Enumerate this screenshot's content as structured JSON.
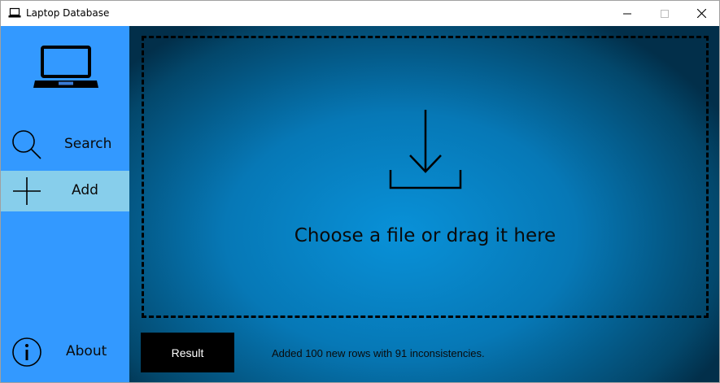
{
  "window": {
    "title": "Laptop Database",
    "app_icon": "laptop-icon",
    "controls": [
      "minimize-icon",
      "maximize-icon",
      "close-icon"
    ]
  },
  "sidebar": {
    "logo_icon": "laptop-icon",
    "items": [
      {
        "label": "Search",
        "icon": "search-icon",
        "selected": false
      },
      {
        "label": "Add",
        "icon": "plus-icon",
        "selected": true
      },
      {
        "label": "About",
        "icon": "info-icon",
        "selected": false
      }
    ]
  },
  "main": {
    "dropzone": {
      "icon": "download-icon",
      "text": "Choose a file or drag it here"
    },
    "result_button": "Result",
    "status": "Added 100 new rows with 91 inconsistencies."
  },
  "colors": {
    "sidebar": "#3399ff",
    "selected_item": "#87ceeb",
    "main_center": "#0991d8",
    "main_edge": "#022f4a",
    "button": "#000000"
  }
}
